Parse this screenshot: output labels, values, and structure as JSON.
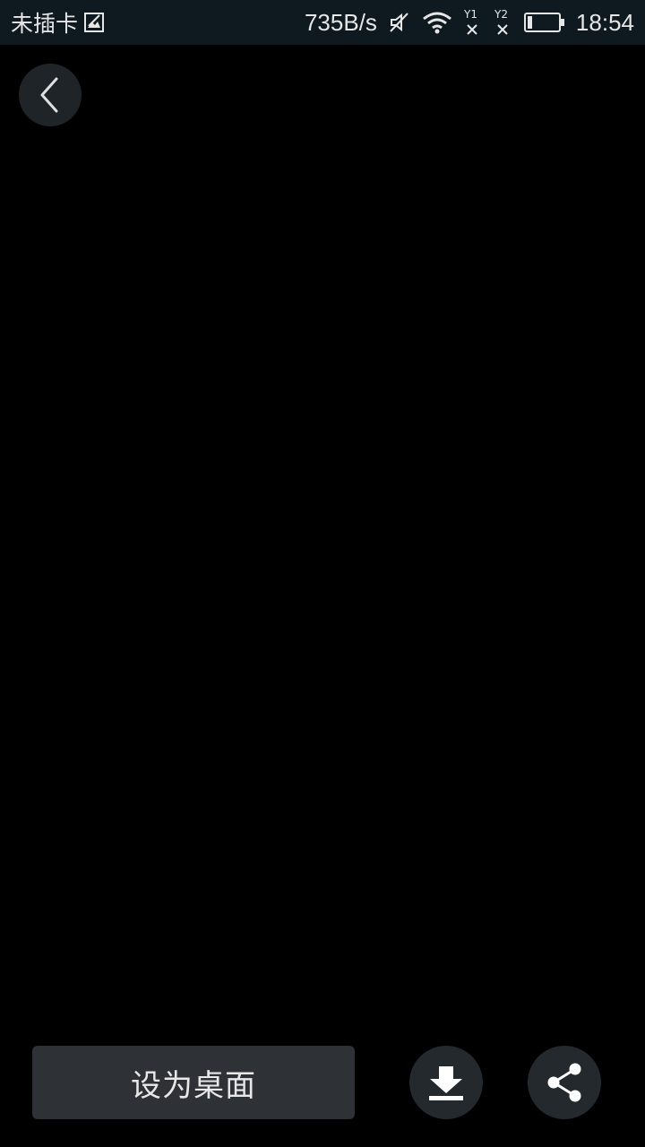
{
  "status_bar": {
    "carrier": "未插卡",
    "network_speed": "735B/s",
    "time": "18:54",
    "icons": [
      "sim-image-icon",
      "mute-icon",
      "wifi-icon",
      "sim1-no-signal-icon",
      "sim2-no-signal-icon",
      "battery-icon"
    ]
  },
  "actions": {
    "set_desktop_label": "设为桌面",
    "back_icon": "chevron-left-icon",
    "download_icon": "download-icon",
    "share_icon": "share-icon"
  },
  "colors": {
    "background": "#000000",
    "status_bar": "#0e1a1f",
    "button": "#2e3236",
    "circle_button": "#24292d",
    "text": "#e8e8e8"
  }
}
